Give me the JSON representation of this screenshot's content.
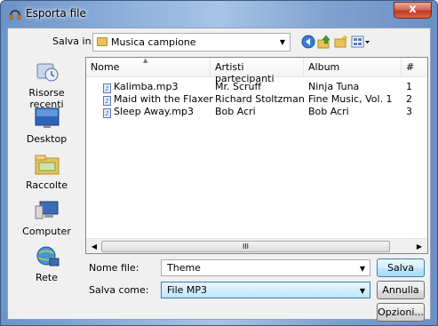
{
  "window": {
    "title": "Esporta file",
    "close_glyph": "x"
  },
  "toolbar": {
    "save_in_label": "Salva in:",
    "save_in_value": "Musica campione",
    "icons": [
      "back-icon",
      "up-folder-icon",
      "new-folder-icon",
      "view-menu-icon"
    ]
  },
  "places": [
    {
      "label": "Risorse recenti",
      "icon": "recent-places-icon"
    },
    {
      "label": "Desktop",
      "icon": "desktop-icon"
    },
    {
      "label": "Raccolte",
      "icon": "libraries-icon"
    },
    {
      "label": "Computer",
      "icon": "computer-icon"
    },
    {
      "label": "Rete",
      "icon": "network-icon"
    }
  ],
  "columns": [
    "Nome",
    "Artisti partecipanti",
    "Album",
    "#"
  ],
  "files": [
    {
      "name": "Kalimba.mp3",
      "artist": "Mr. Scruff",
      "album": "Ninja Tuna",
      "track": "1"
    },
    {
      "name": "Maid with the Flaxen H...",
      "artist": "Richard Stoltzman...",
      "album": "Fine Music, Vol. 1",
      "track": "2"
    },
    {
      "name": "Sleep Away.mp3",
      "artist": "Bob Acri",
      "album": "Bob Acri",
      "track": "3"
    }
  ],
  "scroll": {
    "thumb_glyph": "III"
  },
  "form": {
    "filename_label": "Nome file:",
    "filename_value": "Theme",
    "filetype_label": "Salva come:",
    "filetype_value": "File MP3"
  },
  "buttons": {
    "save": "Salva",
    "cancel": "Annulla",
    "options": "Opzioni..."
  },
  "colors": {
    "title_gradient": "#8fb1dc",
    "close_red": "#c2381f",
    "accent_blue": "#3c7fb1"
  }
}
